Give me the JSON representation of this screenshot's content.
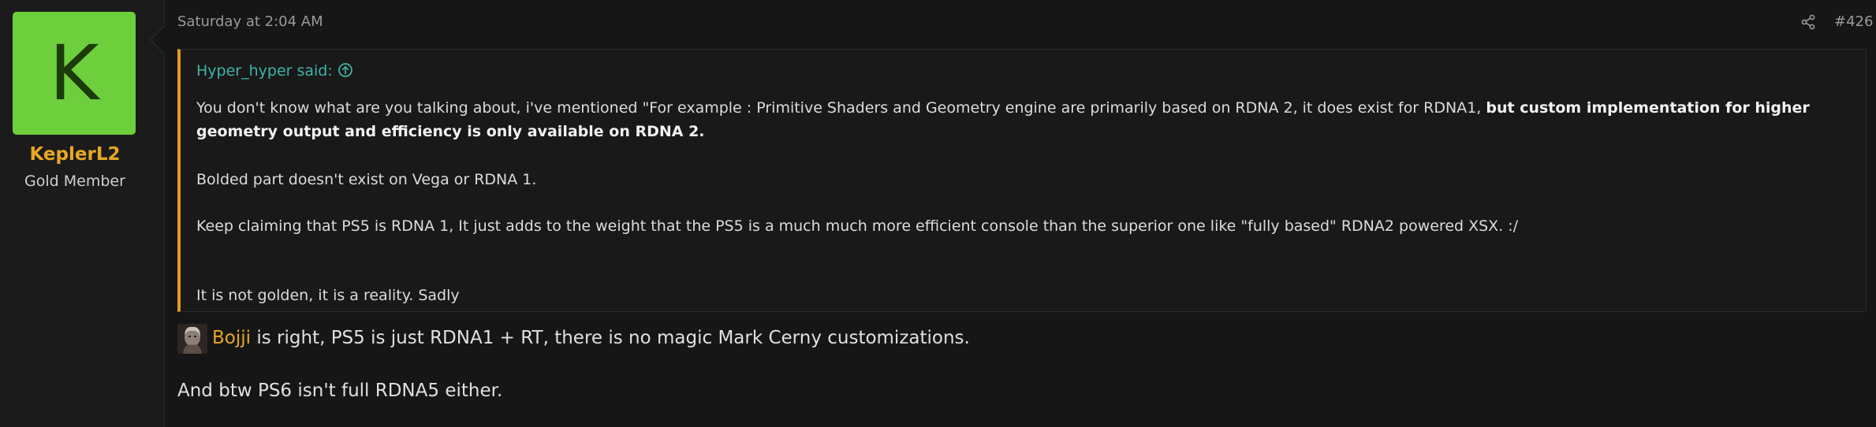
{
  "author": {
    "avatar_letter": "K",
    "avatar_color": "#6ecf3c",
    "username": "KeplerL2",
    "title": "Gold Member"
  },
  "post": {
    "date": "Saturday at 2:04 AM",
    "share_icon": "share-icon",
    "number": "#426"
  },
  "quote": {
    "author": "Hyper_hyper said:",
    "jump_icon": "arrow-up-circle-icon",
    "line1_normal": "You don't know what are you talking about, i've mentioned \"For example : Primitive Shaders and Geometry engine are primarily based on RDNA 2, it does exist for RDNA1, ",
    "line1_bold": "but custom implementation for higher geometry output and efficiency is only available on RDNA 2.",
    "line2": "Bolded part doesn't exist on Vega or RDNA 1.",
    "line3": "Keep claiming that PS5 is RDNA 1, It just adds to the weight that the PS5 is a much much more efficient console than the superior one like \"fully based\" RDNA2 powered XSX. :/",
    "line4": "It is not golden, it is a reality. Sadly"
  },
  "reply": {
    "mention_avatar_icon": "user-avatar",
    "mention_name": "Bojji",
    "mention_text": " is right, PS5 is just RDNA1 + RT, there is no magic Mark Cerny customizations.",
    "line2": "And btw PS6 isn't full RDNA5 either."
  }
}
